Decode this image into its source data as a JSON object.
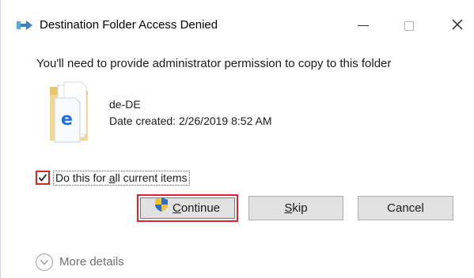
{
  "window": {
    "title": "Destination Folder Access Denied",
    "controls": {
      "minimize": "minimize",
      "maximize": "maximize",
      "close": "close"
    }
  },
  "dialog": {
    "message": "You'll need to provide administrator permission to copy to this folder",
    "file": {
      "name": "de-DE",
      "date_created": "Date created: 2/26/2019 8:52 AM"
    },
    "checkbox": {
      "checked": true,
      "label_pre": "Do this for ",
      "label_access": "a",
      "label_post": "ll current items"
    },
    "buttons": {
      "continue_access": "C",
      "continue_rest": "ontinue",
      "skip_access": "S",
      "skip_rest": "kip",
      "cancel": "Cancel"
    },
    "more_details": "More details"
  },
  "colors": {
    "highlight_red": "#d9252a",
    "button_bg": "#e1e1e1",
    "button_border": "#adadad",
    "muted_text": "#6f6f6f"
  },
  "icons": [
    "copy-arrow-icon",
    "folder-file-icon",
    "uac-shield-icon",
    "checkmark-icon",
    "chevron-down-icon"
  ]
}
